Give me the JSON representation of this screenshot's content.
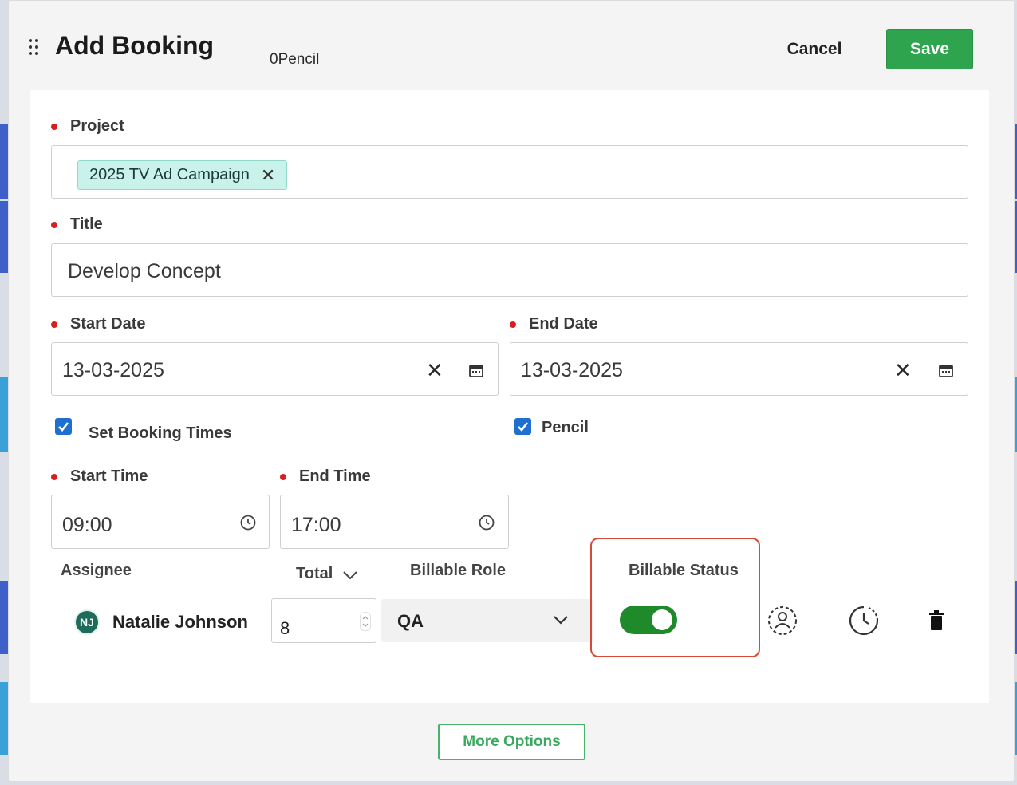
{
  "modal": {
    "title": "Add Booking",
    "subtitle": "0Pencil",
    "cancel_label": "Cancel",
    "save_label": "Save"
  },
  "form": {
    "project": {
      "label": "Project",
      "chip": "2025 TV Ad Campaign"
    },
    "title": {
      "label": "Title",
      "value": "Develop Concept"
    },
    "start_date": {
      "label": "Start Date",
      "value": "13-03-2025"
    },
    "end_date": {
      "label": "End Date",
      "value": "13-03-2025"
    },
    "set_booking_times": {
      "label": "Set Booking Times",
      "checked": true
    },
    "pencil": {
      "label": "Pencil",
      "checked": true
    },
    "start_time": {
      "label": "Start Time",
      "value": "09:00"
    },
    "end_time": {
      "label": "End Time",
      "value": "17:00"
    }
  },
  "assignees": {
    "headers": {
      "assignee": "Assignee",
      "total": "Total",
      "billable_role": "Billable Role",
      "billable_status": "Billable Status"
    },
    "rows": [
      {
        "initials": "NJ",
        "name": "Natalie Johnson",
        "total": "8",
        "role": "QA",
        "billable": true
      }
    ]
  },
  "footer": {
    "more_options_label": "More Options"
  },
  "colors": {
    "primary_green": "#2ea44f",
    "toggle_on": "#1e8a2a",
    "required_dot": "#d61f1f",
    "checkbox_blue": "#1f6fd1",
    "chip_bg": "#c9f2ea",
    "highlight": "#d9493a"
  }
}
